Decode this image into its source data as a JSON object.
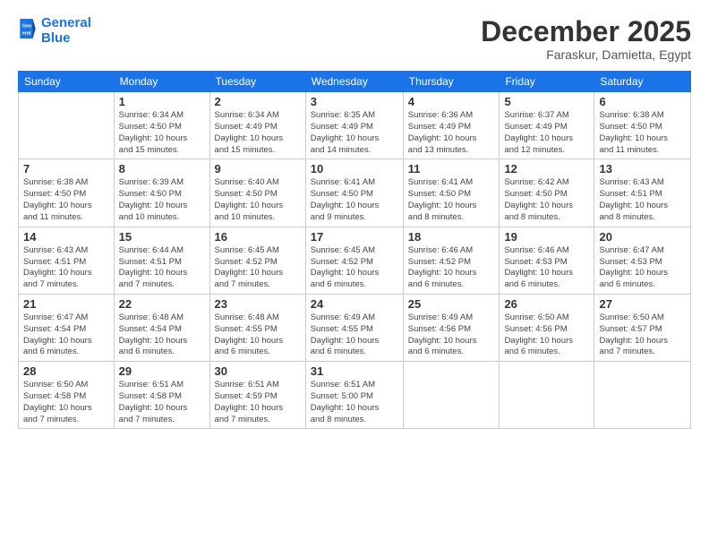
{
  "logo": {
    "line1": "General",
    "line2": "Blue"
  },
  "title": "December 2025",
  "location": "Faraskur, Damietta, Egypt",
  "weekdays": [
    "Sunday",
    "Monday",
    "Tuesday",
    "Wednesday",
    "Thursday",
    "Friday",
    "Saturday"
  ],
  "weeks": [
    [
      {
        "day": "",
        "info": ""
      },
      {
        "day": "1",
        "info": "Sunrise: 6:34 AM\nSunset: 4:50 PM\nDaylight: 10 hours\nand 15 minutes."
      },
      {
        "day": "2",
        "info": "Sunrise: 6:34 AM\nSunset: 4:49 PM\nDaylight: 10 hours\nand 15 minutes."
      },
      {
        "day": "3",
        "info": "Sunrise: 6:35 AM\nSunset: 4:49 PM\nDaylight: 10 hours\nand 14 minutes."
      },
      {
        "day": "4",
        "info": "Sunrise: 6:36 AM\nSunset: 4:49 PM\nDaylight: 10 hours\nand 13 minutes."
      },
      {
        "day": "5",
        "info": "Sunrise: 6:37 AM\nSunset: 4:49 PM\nDaylight: 10 hours\nand 12 minutes."
      },
      {
        "day": "6",
        "info": "Sunrise: 6:38 AM\nSunset: 4:50 PM\nDaylight: 10 hours\nand 11 minutes."
      }
    ],
    [
      {
        "day": "7",
        "info": "Sunrise: 6:38 AM\nSunset: 4:50 PM\nDaylight: 10 hours\nand 11 minutes."
      },
      {
        "day": "8",
        "info": "Sunrise: 6:39 AM\nSunset: 4:50 PM\nDaylight: 10 hours\nand 10 minutes."
      },
      {
        "day": "9",
        "info": "Sunrise: 6:40 AM\nSunset: 4:50 PM\nDaylight: 10 hours\nand 10 minutes."
      },
      {
        "day": "10",
        "info": "Sunrise: 6:41 AM\nSunset: 4:50 PM\nDaylight: 10 hours\nand 9 minutes."
      },
      {
        "day": "11",
        "info": "Sunrise: 6:41 AM\nSunset: 4:50 PM\nDaylight: 10 hours\nand 8 minutes."
      },
      {
        "day": "12",
        "info": "Sunrise: 6:42 AM\nSunset: 4:50 PM\nDaylight: 10 hours\nand 8 minutes."
      },
      {
        "day": "13",
        "info": "Sunrise: 6:43 AM\nSunset: 4:51 PM\nDaylight: 10 hours\nand 8 minutes."
      }
    ],
    [
      {
        "day": "14",
        "info": "Sunrise: 6:43 AM\nSunset: 4:51 PM\nDaylight: 10 hours\nand 7 minutes."
      },
      {
        "day": "15",
        "info": "Sunrise: 6:44 AM\nSunset: 4:51 PM\nDaylight: 10 hours\nand 7 minutes."
      },
      {
        "day": "16",
        "info": "Sunrise: 6:45 AM\nSunset: 4:52 PM\nDaylight: 10 hours\nand 7 minutes."
      },
      {
        "day": "17",
        "info": "Sunrise: 6:45 AM\nSunset: 4:52 PM\nDaylight: 10 hours\nand 6 minutes."
      },
      {
        "day": "18",
        "info": "Sunrise: 6:46 AM\nSunset: 4:52 PM\nDaylight: 10 hours\nand 6 minutes."
      },
      {
        "day": "19",
        "info": "Sunrise: 6:46 AM\nSunset: 4:53 PM\nDaylight: 10 hours\nand 6 minutes."
      },
      {
        "day": "20",
        "info": "Sunrise: 6:47 AM\nSunset: 4:53 PM\nDaylight: 10 hours\nand 6 minutes."
      }
    ],
    [
      {
        "day": "21",
        "info": "Sunrise: 6:47 AM\nSunset: 4:54 PM\nDaylight: 10 hours\nand 6 minutes."
      },
      {
        "day": "22",
        "info": "Sunrise: 6:48 AM\nSunset: 4:54 PM\nDaylight: 10 hours\nand 6 minutes."
      },
      {
        "day": "23",
        "info": "Sunrise: 6:48 AM\nSunset: 4:55 PM\nDaylight: 10 hours\nand 6 minutes."
      },
      {
        "day": "24",
        "info": "Sunrise: 6:49 AM\nSunset: 4:55 PM\nDaylight: 10 hours\nand 6 minutes."
      },
      {
        "day": "25",
        "info": "Sunrise: 6:49 AM\nSunset: 4:56 PM\nDaylight: 10 hours\nand 6 minutes."
      },
      {
        "day": "26",
        "info": "Sunrise: 6:50 AM\nSunset: 4:56 PM\nDaylight: 10 hours\nand 6 minutes."
      },
      {
        "day": "27",
        "info": "Sunrise: 6:50 AM\nSunset: 4:57 PM\nDaylight: 10 hours\nand 7 minutes."
      }
    ],
    [
      {
        "day": "28",
        "info": "Sunrise: 6:50 AM\nSunset: 4:58 PM\nDaylight: 10 hours\nand 7 minutes."
      },
      {
        "day": "29",
        "info": "Sunrise: 6:51 AM\nSunset: 4:58 PM\nDaylight: 10 hours\nand 7 minutes."
      },
      {
        "day": "30",
        "info": "Sunrise: 6:51 AM\nSunset: 4:59 PM\nDaylight: 10 hours\nand 7 minutes."
      },
      {
        "day": "31",
        "info": "Sunrise: 6:51 AM\nSunset: 5:00 PM\nDaylight: 10 hours\nand 8 minutes."
      },
      {
        "day": "",
        "info": ""
      },
      {
        "day": "",
        "info": ""
      },
      {
        "day": "",
        "info": ""
      }
    ]
  ]
}
